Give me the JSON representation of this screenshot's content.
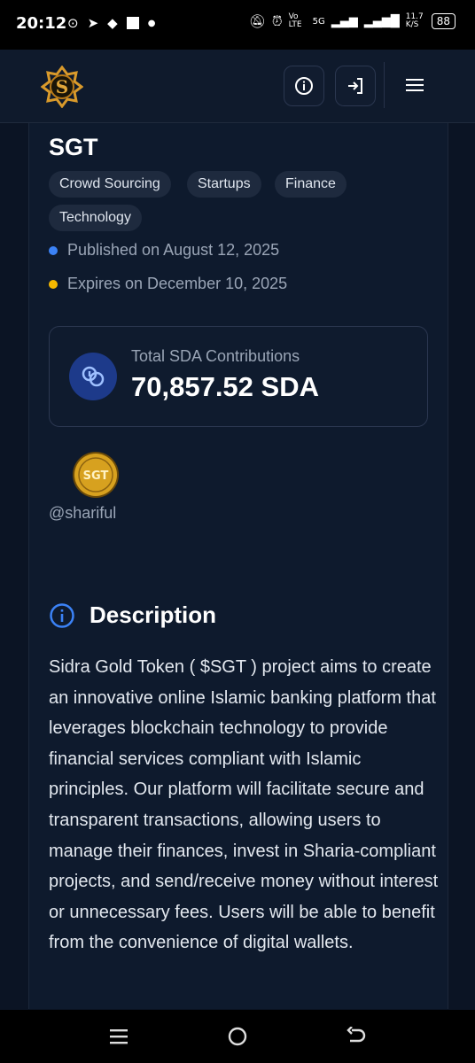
{
  "status_bar": {
    "time": "20:12",
    "network_speed": "11.7\nK/S",
    "network_labels": [
      "Vo LTE",
      "5G"
    ],
    "battery": "88"
  },
  "header": {
    "logo_icon": "sidra-logo-icon",
    "info_icon": "info-icon",
    "login_icon": "login-icon",
    "menu_icon": "hamburger-menu-icon"
  },
  "project": {
    "title": "SGT",
    "tags": [
      "Crowd Sourcing",
      "Startups",
      "Finance",
      "Technology"
    ],
    "published": "Published on August 12, 2025",
    "expires": "Expires on December 10, 2025",
    "contribution_label": "Total SDA Contributions",
    "contribution_value": "70,857.52 SDA",
    "avatar_text": "SGT",
    "username": "@shariful"
  },
  "description": {
    "heading": "Description",
    "body": "Sidra Gold Token ( $SGT ) project aims to create an innovative online Islamic banking platform that leverages blockchain technology to provide financial services compliant with Islamic principles. Our platform will facilitate secure and transparent transactions, allowing users to manage their finances, invest in Sharia-compliant projects, and send/receive money without interest or unnecessary fees. Users will be able to benefit from the convenience of digital wallets."
  },
  "colors": {
    "published_dot": "#3b82f6",
    "expires_dot": "#f5b800",
    "accent_blue": "#3b82f6"
  }
}
